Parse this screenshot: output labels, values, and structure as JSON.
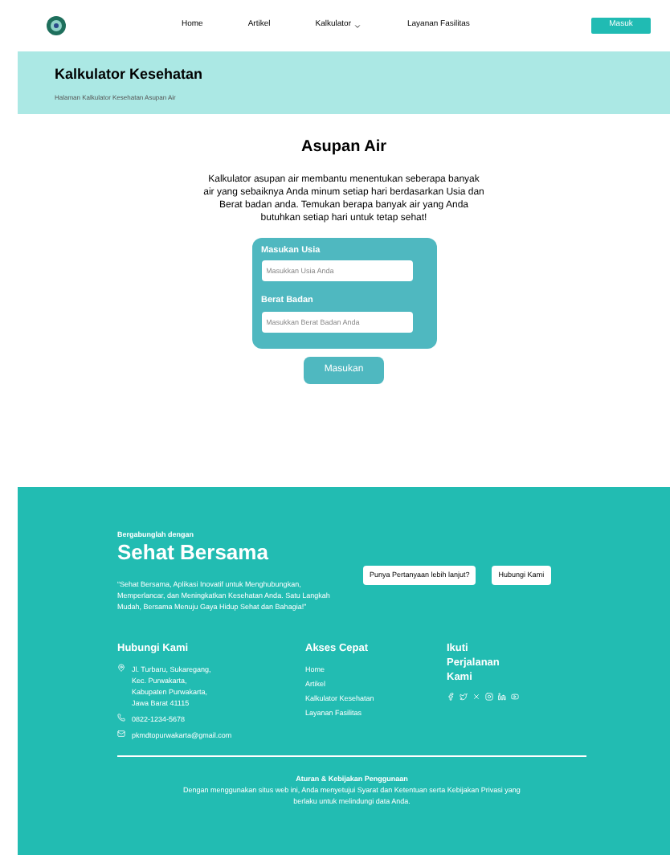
{
  "nav": {
    "items": [
      {
        "label": "Home",
        "dropdown": false
      },
      {
        "label": "Artikel",
        "dropdown": false
      },
      {
        "label": "Kalkulator",
        "dropdown": true
      },
      {
        "label": "Layanan Fasilitas",
        "dropdown": false
      }
    ],
    "button": "Masuk"
  },
  "banner": {
    "title": "Kalkulator Kesehatan",
    "subtitle": "Halaman Kalkulator Kesehatan Asupan Air"
  },
  "main": {
    "title": "Asupan Air",
    "description": "Kalkulator asupan air membantu menentukan seberapa banyak air yang sebaiknya Anda minum setiap hari berdasarkan Usia dan Berat badan anda. Temukan berapa banyak air yang Anda butuhkan setiap hari untuk tetap sehat!",
    "fields": [
      {
        "label": "Masukan Usia",
        "placeholder": "Masukkan Usia Anda"
      },
      {
        "label": "Berat Badan",
        "placeholder": "Masukkan Berat Badan Anda"
      }
    ],
    "submit": "Masukan"
  },
  "footer": {
    "kicker": "Bergabunglah dengan",
    "brand": "Sehat Bersama",
    "quote": "“Sehat Bersama, Aplikasi Inovatif untuk Menghubungkan, Memperlancar, dan Meningkatkan Kesehatan Anda. Satu Langkah Mudah, Bersama Menuju Gaya Hidup Sehat dan Bahagia!”",
    "buttons": [
      "Punya Pertanyaan lebih lanjut?",
      "Hubungi Kami"
    ],
    "contact": {
      "title": "Hubungi Kami",
      "items": [
        {
          "kind": "address",
          "text": "Jl. Turbaru, Sukaregang, Kec. Purwakarta, Kabupaten Purwakarta, Jawa Barat 41115"
        },
        {
          "kind": "phone",
          "text": "0822-1234-5678"
        },
        {
          "kind": "email",
          "text": "pkmdtopurwakarta@gmail.com"
        }
      ]
    },
    "links": {
      "title": "Akses Cepat",
      "items": [
        "Home",
        "Artikel",
        "Kalkulator Kesehatan",
        "Layanan Fasilitas"
      ]
    },
    "social": {
      "title": "Ikuti Perjalanan Kami"
    },
    "policy": {
      "title": "Aturan & Kebijakan Penggunaan",
      "text": "Dengan menggunakan situs web ini, Anda menyetujui Syarat dan Ketentuan serta Kebijakan Privasi yang berlaku untuk melindungi data Anda."
    }
  }
}
